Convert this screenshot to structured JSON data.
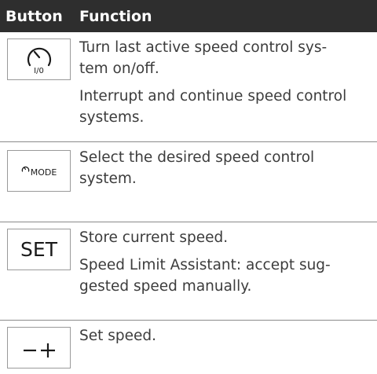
{
  "header": {
    "button_label": "Button",
    "function_label": "Function"
  },
  "rows": [
    {
      "icon": "speed-control-on-off-icon",
      "icon_text": "I/0",
      "functions": [
        "Turn last active speed control sys-\ntem on/off.",
        "Interrupt and continue speed control\nsystems."
      ]
    },
    {
      "icon": "speed-control-mode-icon",
      "icon_text": "MODE",
      "functions": [
        "Select the desired speed control\nsystem."
      ]
    },
    {
      "icon": "set-icon",
      "icon_text": "SET",
      "functions": [
        "Store current speed.",
        "Speed Limit Assistant: accept sug-\ngested speed manually."
      ]
    },
    {
      "icon": "minus-plus-icon",
      "icon_text": "−+",
      "functions": [
        "Set speed."
      ]
    }
  ]
}
